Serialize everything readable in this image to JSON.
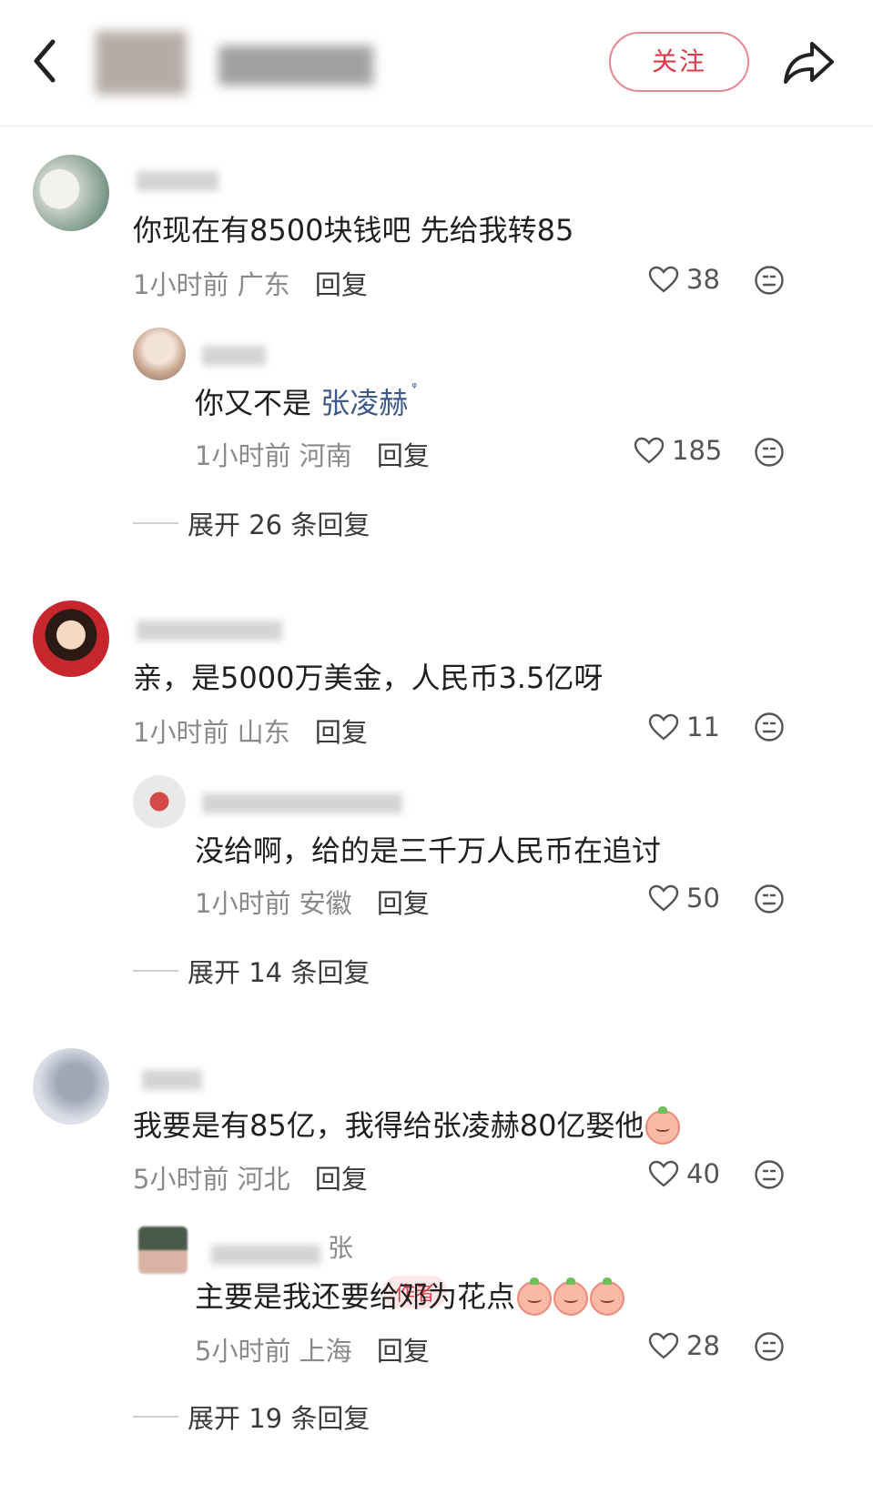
{
  "header": {
    "follow_label": "关注"
  },
  "colors": {
    "accent": "#e03a4a",
    "link": "#3d5a8a"
  },
  "comments": [
    {
      "text": "你现在有8500块钱吧 先给我转85",
      "time": "1小时前",
      "location": "广东",
      "reply_label": "回复",
      "likes": "38",
      "replies": [
        {
          "text_prefix": "你又不是 ",
          "link_text": "张凌赫",
          "time": "1小时前",
          "location": "河南",
          "reply_label": "回复",
          "likes": "185"
        }
      ],
      "expand_label": "展开 26 条回复"
    },
    {
      "text": "亲，是5000万美金，人民币3.5亿呀",
      "time": "1小时前",
      "location": "山东",
      "reply_label": "回复",
      "likes": "11",
      "replies": [
        {
          "text": "没给啊，给的是三千万人民币在追讨",
          "time": "1小时前",
          "location": "安徽",
          "reply_label": "回复",
          "likes": "50"
        }
      ],
      "expand_label": "展开 14 条回复"
    },
    {
      "text": "我要是有85亿，我得给张凌赫80亿娶他",
      "time": "5小时前",
      "location": "河北",
      "reply_label": "回复",
      "likes": "40",
      "replies": [
        {
          "name_suffix": "张",
          "badge": "作者",
          "text": "主要是我还要给邓为花点",
          "time": "5小时前",
          "location": "上海",
          "reply_label": "回复",
          "likes": "28"
        }
      ],
      "expand_label": "展开 19 条回复"
    }
  ]
}
